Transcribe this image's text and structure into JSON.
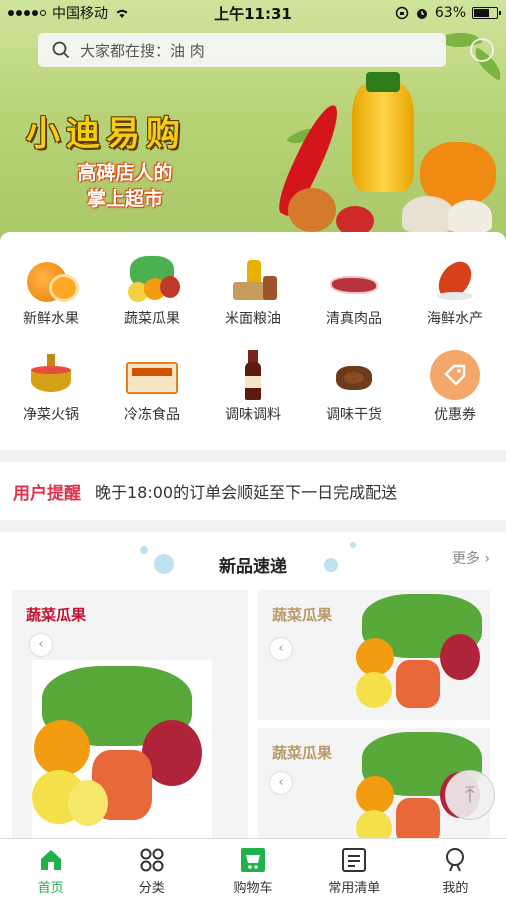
{
  "status_bar": {
    "carrier": "中国移动",
    "time": "上午11:31",
    "battery": "63%"
  },
  "search": {
    "placeholder": "大家都在搜：油 肉"
  },
  "banner": {
    "brand": "小迪易购",
    "slogan_line1": "高碑店人的",
    "slogan_line2": "掌上超市"
  },
  "categories": [
    {
      "label": "新鲜水果",
      "icon": "orange-fruit-icon"
    },
    {
      "label": "蔬菜瓜果",
      "icon": "vegetables-icon"
    },
    {
      "label": "米面粮油",
      "icon": "grain-oil-icon"
    },
    {
      "label": "清真肉品",
      "icon": "meat-icon"
    },
    {
      "label": "海鲜水产",
      "icon": "seafood-icon"
    },
    {
      "label": "净菜火锅",
      "icon": "hotpot-icon"
    },
    {
      "label": "冷冻食品",
      "icon": "frozen-food-icon"
    },
    {
      "label": "调味调料",
      "icon": "seasoning-bottle-icon"
    },
    {
      "label": "调味干货",
      "icon": "dried-spice-icon"
    },
    {
      "label": "优惠券",
      "icon": "coupon-tag-icon"
    }
  ],
  "notice": {
    "tag": "用户提醒",
    "text": "晚于18:00的订单会顺延至下一日完成配送"
  },
  "new_products": {
    "title": "新品速递",
    "more": "更多 ›",
    "cards": [
      {
        "name": "蔬菜瓜果",
        "color": "#c8102e"
      },
      {
        "name": "蔬菜瓜果",
        "color": "#b89b6a"
      },
      {
        "name": "蔬菜瓜果",
        "color": "#b89b6a"
      }
    ]
  },
  "tabs": [
    {
      "label": "首页",
      "icon": "home-icon",
      "active": true
    },
    {
      "label": "分类",
      "icon": "category-grid-icon",
      "active": false
    },
    {
      "label": "购物车",
      "icon": "cart-icon",
      "active": false
    },
    {
      "label": "常用清单",
      "icon": "list-icon",
      "active": false
    },
    {
      "label": "我的",
      "icon": "profile-icon",
      "active": false
    }
  ],
  "colors": {
    "accent_green": "#1fb24a",
    "notice_red": "#e2324b",
    "brand_yellow": "#f5cd16"
  }
}
